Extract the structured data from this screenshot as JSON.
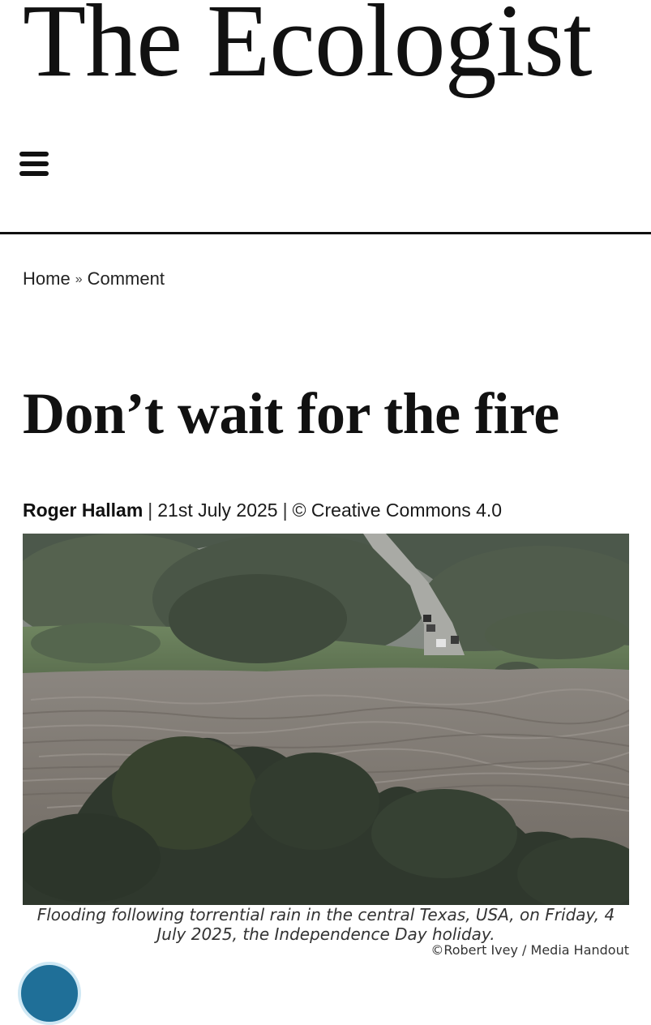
{
  "site": {
    "title": "The Ecologist"
  },
  "breadcrumb": {
    "home": "Home",
    "separator": "»",
    "current": "Comment"
  },
  "article": {
    "headline": "Don’t wait for the fire",
    "byline": {
      "author": "Roger Hallam",
      "separator": "|",
      "date": "21st July 2025",
      "license": "© Creative Commons 4.0"
    },
    "image": {
      "caption": "Flooding following torrential rain in the central Texas, USA, on Friday, 4 July 2025, the Independence Day holiday.",
      "credit": "©Robert Ivey / Media Handout"
    }
  },
  "icons": {
    "menu": "hamburger-menu-icon"
  },
  "colors": {
    "text": "#111111",
    "rule": "#111111",
    "background": "#ffffff"
  }
}
